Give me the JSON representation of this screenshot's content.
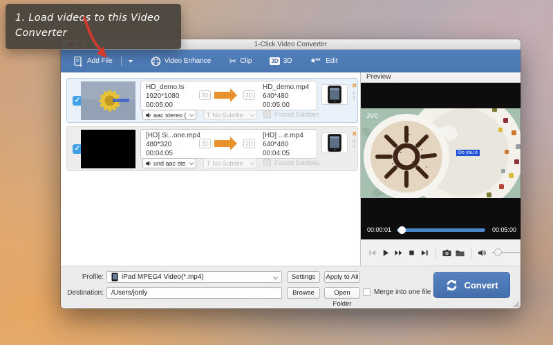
{
  "tooltip": {
    "text": "1. Load videos to this Video Converter"
  },
  "window": {
    "title": "1-Click Video Converter",
    "toolbar": {
      "add_file": "Add File",
      "video_enhance": "Video Enhance",
      "clip": "Clip",
      "three_d_badge": "3D",
      "three_d_label": "3D",
      "edit": "Edit"
    },
    "list": {
      "rows": [
        {
          "checked": "✓",
          "source": {
            "name": "HD_demo.ts",
            "resolution": "1920*1080",
            "duration": "00:05:00"
          },
          "badge_left": "2D",
          "badge_right": "2D",
          "target": {
            "name": "HD_demo.mp4",
            "resolution": "640*480",
            "duration": "00:05:00"
          },
          "audio": "aac stereo (",
          "subtitle_prefix": "T",
          "subtitle": "No Subtitle",
          "forced_subtitles": "Forced Subtitles",
          "close": "✕",
          "up": "∧",
          "down": "∨"
        },
        {
          "checked": "✓",
          "source": {
            "name": "[HD] Si...one.mp4",
            "resolution": "480*320",
            "duration": "00:04:05"
          },
          "badge_left": "2D",
          "badge_right": "2D",
          "target": {
            "name": "[HD] ...e.mp4",
            "resolution": "640*480",
            "duration": "00:04:05"
          },
          "audio": "und aac ste",
          "subtitle_prefix": "T",
          "subtitle": "No Subtitle",
          "forced_subtitles": "Forced Subtitles",
          "close": "✕",
          "up": "∧",
          "down": "∨"
        }
      ]
    },
    "preview": {
      "header": "Preview",
      "watermark": "JVC",
      "subtitle_overlay": "Do you e",
      "current_time": "00:00:01",
      "total_time": "00:05:00"
    },
    "bottom": {
      "profile_label": "Profile:",
      "profile_value": "iPad MPEG4 Video(*.mp4)",
      "settings": "Settings",
      "apply_to_all": "Apply to All",
      "destination_label": "Destination:",
      "destination_value": "/Users/jonly",
      "browse": "Browse",
      "open_folder": "Open Folder",
      "merge_label": "Merge into one file",
      "convert": "Convert"
    },
    "colors": {
      "toolbar_blue": "#4a77b2",
      "accent_blue": "#4a86c8",
      "convert_blue": "#4470ad",
      "arrow_orange": "#e8912d",
      "callout_red": "#d23a2c"
    }
  }
}
